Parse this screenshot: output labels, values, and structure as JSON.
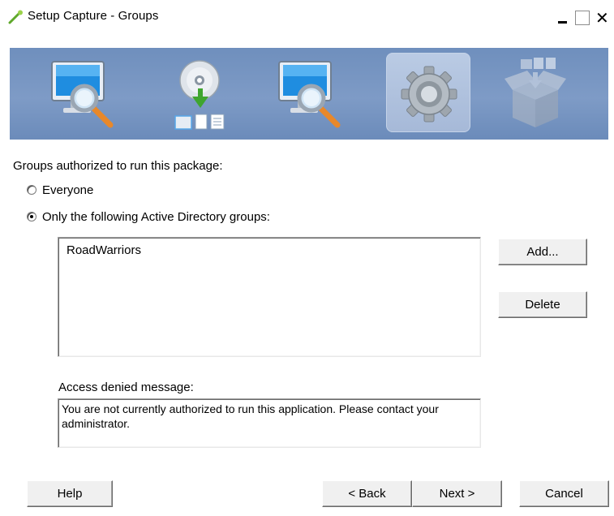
{
  "window": {
    "title": "Setup Capture - Groups",
    "controls": {
      "minimize": "_",
      "maximize": "□",
      "close": "×"
    }
  },
  "wizard_steps": [
    {
      "icon": "monitor-magnifier-icon",
      "active": false
    },
    {
      "icon": "disc-install-icon",
      "active": false
    },
    {
      "icon": "monitor-magnifier-icon",
      "active": false
    },
    {
      "icon": "gear-icon",
      "active": true
    },
    {
      "icon": "package-box-icon",
      "active": false
    }
  ],
  "groups": {
    "heading": "Groups authorized to run this package:",
    "options": [
      {
        "label": "Everyone",
        "selected": false
      },
      {
        "label": "Only the following Active Directory groups:",
        "selected": true
      }
    ],
    "list_items": [
      "RoadWarriors"
    ],
    "add_label": "Add...",
    "delete_label": "Delete"
  },
  "access": {
    "label": "Access denied message:",
    "message": "You are not currently authorized to run this application. Please contact your administrator."
  },
  "footer": {
    "help_label": "Help",
    "back_label": "< Back",
    "next_label": "Next >",
    "cancel_label": "Cancel"
  },
  "colors": {
    "banner": "#7e9bc6",
    "active_step": "#b0c2de",
    "dialog_bg": "#ffffff"
  }
}
